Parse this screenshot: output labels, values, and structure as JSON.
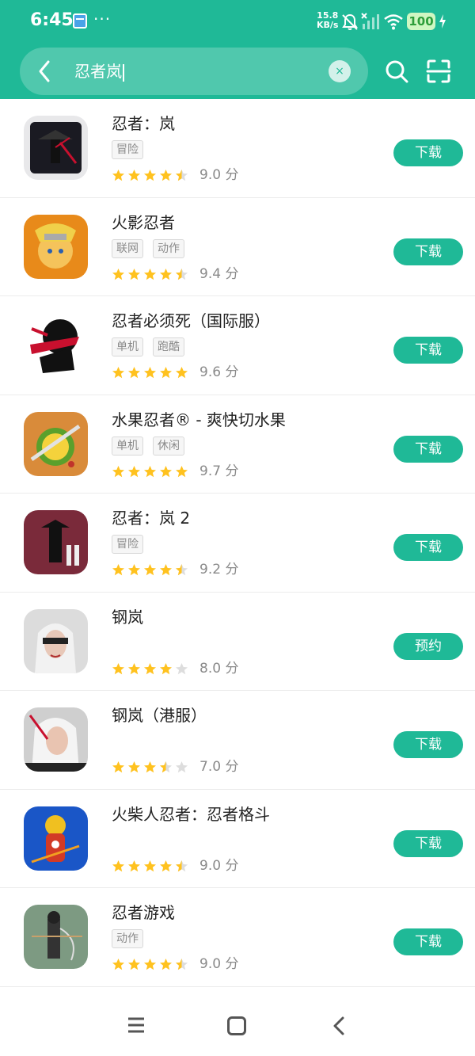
{
  "status_bar": {
    "time": "6:45",
    "more": "···",
    "net_speed_value": "15.8",
    "net_speed_unit": "KB/s",
    "battery": "100"
  },
  "search": {
    "query": "忍者岚",
    "clear_icon": "×"
  },
  "icons": {
    "back": "chevron-left-icon",
    "search": "search-icon",
    "scan": "scan-icon",
    "clear": "close-icon"
  },
  "colors": {
    "accent": "#1fb997",
    "star": "#ffc21f",
    "star_empty": "#dddddd"
  },
  "apps": [
    {
      "name": "忍者：岚",
      "tags": [
        "冒险"
      ],
      "stars": 4.5,
      "rating": "9.0 分",
      "button": "下载"
    },
    {
      "name": "火影忍者",
      "tags": [
        "联网",
        "动作"
      ],
      "stars": 4.5,
      "rating": "9.4 分",
      "button": "下载"
    },
    {
      "name": "忍者必须死（国际服）",
      "tags": [
        "单机",
        "跑酷"
      ],
      "stars": 5,
      "rating": "9.6 分",
      "button": "下载"
    },
    {
      "name": "水果忍者® - 爽快切水果",
      "tags": [
        "单机",
        "休闲"
      ],
      "stars": 5,
      "rating": "9.7 分",
      "button": "下载"
    },
    {
      "name": "忍者：岚 2",
      "tags": [
        "冒险"
      ],
      "stars": 4.5,
      "rating": "9.2 分",
      "button": "下载"
    },
    {
      "name": " 钢岚",
      "tags": [],
      "stars": 4,
      "rating": "8.0 分",
      "button": "预约"
    },
    {
      "name": "钢岚（港服）",
      "tags": [],
      "stars": 3.5,
      "rating": "7.0 分",
      "button": "下载"
    },
    {
      "name": "火柴人忍者：忍者格斗",
      "tags": [],
      "stars": 4.5,
      "rating": "9.0 分",
      "button": "下载"
    },
    {
      "name": "忍者游戏",
      "tags": [
        "动作"
      ],
      "stars": 4.5,
      "rating": "9.0 分",
      "button": "下载"
    }
  ],
  "nav": {
    "menu": "menu-icon",
    "home": "home-icon",
    "back": "back-icon"
  }
}
